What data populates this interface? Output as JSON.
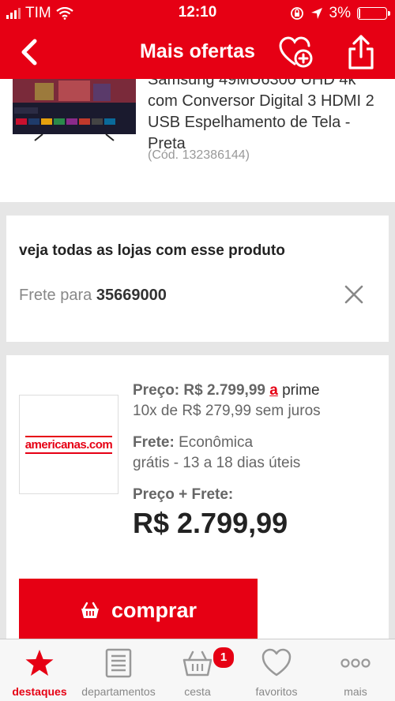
{
  "status_bar": {
    "carrier": "TIM",
    "time": "12:10",
    "battery": "3%"
  },
  "nav": {
    "title": "Mais ofertas"
  },
  "product": {
    "name": "Samsung 49MU6300 UHD 4k com Conversor Digital 3 HDMI 2 USB Espelhamento de Tela - Preta",
    "code": "(Cód. 132386144)"
  },
  "stores": {
    "heading": "veja todas as lojas com esse produto",
    "frete_label": "Frete para",
    "cep": "35669000"
  },
  "offer": {
    "store_logo": "americanas.com",
    "price_label": "Preço:",
    "price": "R$ 2.799,99",
    "prime_badge": "a",
    "prime_text": "prime",
    "installments": "10x de R$ 279,99 sem juros",
    "frete_label": "Frete:",
    "frete_type": "Econômica",
    "frete_detail": "grátis - 13 a 18 dias úteis",
    "total_label": "Preço + Frete:",
    "total_value": "R$ 2.799,99",
    "buy_label": "comprar"
  },
  "tabs": [
    {
      "label": "destaques",
      "icon": "star-icon",
      "active": true
    },
    {
      "label": "departamentos",
      "icon": "list-icon"
    },
    {
      "label": "cesta",
      "icon": "basket-icon",
      "badge": "1"
    },
    {
      "label": "favoritos",
      "icon": "heart-icon"
    },
    {
      "label": "mais",
      "icon": "more-icon"
    }
  ],
  "colors": {
    "brand_red": "#e60014",
    "background": "#e6e6e6"
  }
}
